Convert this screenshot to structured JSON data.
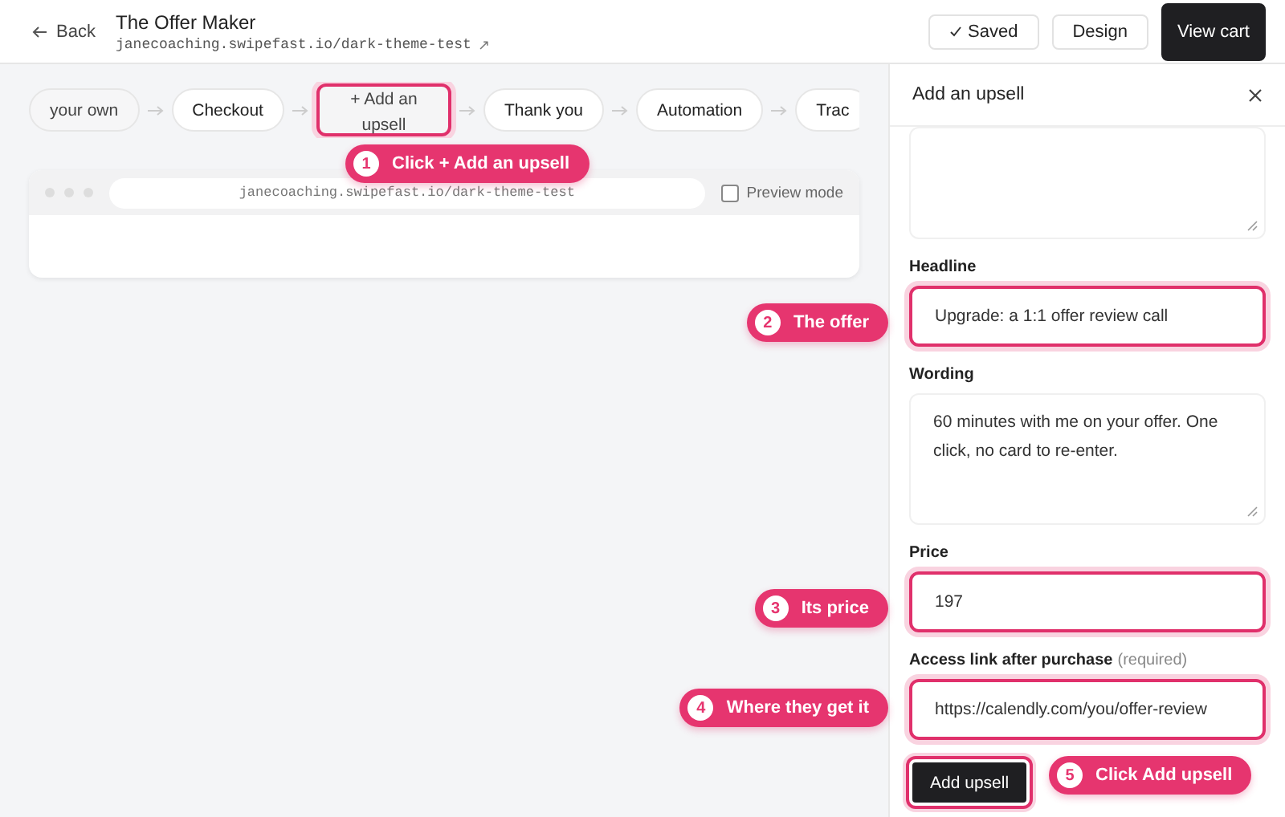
{
  "header": {
    "back": "Back",
    "title": "The Offer Maker",
    "url": "janecoaching.swipefast.io/dark-theme-test",
    "external": "↗",
    "saved": "Saved",
    "design": "Design",
    "view_cart": "View cart"
  },
  "steps": [
    {
      "label": "your own",
      "highlighted": false,
      "faded": true
    },
    {
      "label": "Checkout",
      "highlighted": false,
      "faded": false
    },
    {
      "label": "+ Add an upsell",
      "highlighted": true,
      "faded": false
    },
    {
      "label": "Thank you",
      "highlighted": false,
      "faded": false
    },
    {
      "label": "Automation",
      "highlighted": false,
      "faded": false
    },
    {
      "label": "Trac",
      "highlighted": false,
      "faded": false
    }
  ],
  "preview": {
    "url": "janecoaching.swipefast.io/dark-theme-test",
    "preview_mode": {
      "label": "Preview mode",
      "checked": false
    }
  },
  "panel": {
    "title": "Add an upsell",
    "fields": [
      {
        "kind": "textarea",
        "highlighted": false
      },
      {
        "kind": "input",
        "label": "Headline",
        "value": "Upgrade: a 1:1 offer review call",
        "highlighted": true
      },
      {
        "kind": "textarea",
        "label": "Wording",
        "value": "60 minutes with me on your offer. One click, no card to re-enter.",
        "highlighted": false
      },
      {
        "kind": "input",
        "label": "Price",
        "value": "197",
        "highlighted": true
      },
      {
        "kind": "input",
        "label": "Access link after purchase",
        "note": "(required)",
        "value": "https://calendly.com/you/offer-review",
        "highlighted": true
      }
    ],
    "submit": {
      "label": "Add upsell",
      "highlighted": true
    }
  },
  "callouts": [
    {
      "number": "1",
      "text": "Click + Add an upsell"
    },
    {
      "number": "2",
      "text": "The offer"
    },
    {
      "number": "3",
      "text": "Its price"
    },
    {
      "number": "4",
      "text": "Where they get it"
    },
    {
      "number": "5",
      "text": "Click Add upsell"
    }
  ]
}
